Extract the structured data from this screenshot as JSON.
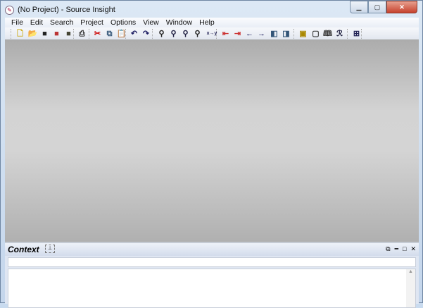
{
  "window": {
    "title": "(No Project) - Source Insight"
  },
  "menu": [
    "File",
    "Edit",
    "Search",
    "Project",
    "Options",
    "View",
    "Window",
    "Help"
  ],
  "toolbar": [
    {
      "name": "new-file",
      "glyph": "🗋",
      "color": "#c9a400"
    },
    {
      "name": "open-file",
      "glyph": "📂",
      "color": "#d9a400"
    },
    {
      "name": "save",
      "glyph": "■",
      "color": "#222"
    },
    {
      "name": "save-as",
      "glyph": "■",
      "color": "#b33"
    },
    {
      "name": "save-all",
      "glyph": "■",
      "color": "#443"
    },
    {
      "name": "print",
      "glyph": "⎙",
      "color": "#333"
    },
    {
      "name": "cut",
      "glyph": "✂",
      "color": "#c00"
    },
    {
      "name": "copy",
      "glyph": "⧉",
      "color": "#357"
    },
    {
      "name": "paste",
      "glyph": "📋",
      "color": "#555"
    },
    {
      "name": "undo",
      "glyph": "↶",
      "color": "#226"
    },
    {
      "name": "redo",
      "glyph": "↷",
      "color": "#226"
    },
    {
      "name": "search",
      "glyph": "⚲",
      "color": "#222"
    },
    {
      "name": "search-backward",
      "glyph": "⚲",
      "color": "#224"
    },
    {
      "name": "search-forward",
      "glyph": "⚲",
      "color": "#224"
    },
    {
      "name": "search-files",
      "glyph": "⚲",
      "color": "#222"
    },
    {
      "name": "replace",
      "glyph": "x→y",
      "color": "#225"
    },
    {
      "name": "bookmark-prev",
      "glyph": "⇤",
      "color": "#c33"
    },
    {
      "name": "bookmark-next",
      "glyph": "⇥",
      "color": "#c33"
    },
    {
      "name": "go-back",
      "glyph": "←",
      "color": "#115"
    },
    {
      "name": "go-forward",
      "glyph": "→",
      "color": "#115"
    },
    {
      "name": "prev-window",
      "glyph": "◧",
      "color": "#357"
    },
    {
      "name": "next-window",
      "glyph": "◨",
      "color": "#357"
    },
    {
      "name": "symbol-info",
      "glyph": "▣",
      "color": "#a80"
    },
    {
      "name": "new-symbol",
      "glyph": "▢",
      "color": "#333"
    },
    {
      "name": "browse-book",
      "glyph": "🕮",
      "color": "#333"
    },
    {
      "name": "relation",
      "glyph": "ℛ",
      "color": "#113"
    },
    {
      "name": "layout",
      "glyph": "⊞",
      "color": "#225"
    }
  ],
  "context": {
    "title": "Context"
  }
}
